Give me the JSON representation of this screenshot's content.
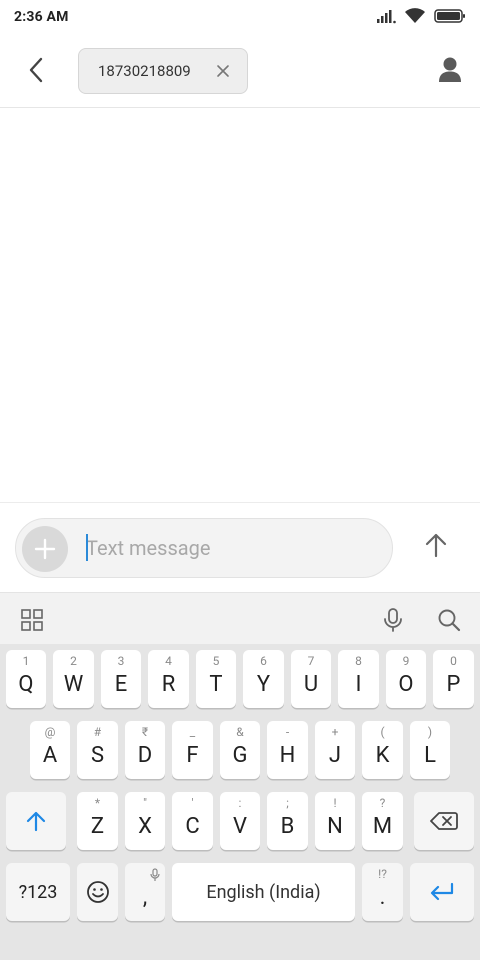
{
  "status": {
    "time": "2:36 AM"
  },
  "header": {
    "recipient": "18730218809",
    "icons": {
      "back": "back-arrow-icon",
      "remove": "close-icon",
      "contact": "person-icon"
    }
  },
  "compose": {
    "placeholder": "Text message",
    "value": "",
    "icons": {
      "attach": "plus-icon",
      "send": "send-arrow-icon"
    }
  },
  "keyboard": {
    "toolbar_icons": [
      "grid-icon",
      "mic-icon",
      "search-icon"
    ],
    "row1": [
      {
        "main": "Q",
        "hint": "1"
      },
      {
        "main": "W",
        "hint": "2"
      },
      {
        "main": "E",
        "hint": "3"
      },
      {
        "main": "R",
        "hint": "4"
      },
      {
        "main": "T",
        "hint": "5"
      },
      {
        "main": "Y",
        "hint": "6"
      },
      {
        "main": "U",
        "hint": "7"
      },
      {
        "main": "I",
        "hint": "8"
      },
      {
        "main": "O",
        "hint": "9"
      },
      {
        "main": "P",
        "hint": "0"
      }
    ],
    "row2": [
      {
        "main": "A",
        "hint": "@"
      },
      {
        "main": "S",
        "hint": "#"
      },
      {
        "main": "D",
        "hint": "₹"
      },
      {
        "main": "F",
        "hint": "_"
      },
      {
        "main": "G",
        "hint": "&"
      },
      {
        "main": "H",
        "hint": "-"
      },
      {
        "main": "J",
        "hint": "+"
      },
      {
        "main": "K",
        "hint": "("
      },
      {
        "main": "L",
        "hint": ")"
      }
    ],
    "row3": [
      {
        "main": "Z",
        "hint": "*"
      },
      {
        "main": "X",
        "hint": "\""
      },
      {
        "main": "C",
        "hint": "'"
      },
      {
        "main": "V",
        "hint": ":"
      },
      {
        "main": "B",
        "hint": ";"
      },
      {
        "main": "N",
        "hint": "!"
      },
      {
        "main": "M",
        "hint": "?"
      }
    ],
    "row4": {
      "symbols": "?123",
      "comma": ",",
      "space": "English (India)",
      "period": ".",
      "period_hint": "!?"
    },
    "accent_color": "#1e88e5"
  }
}
